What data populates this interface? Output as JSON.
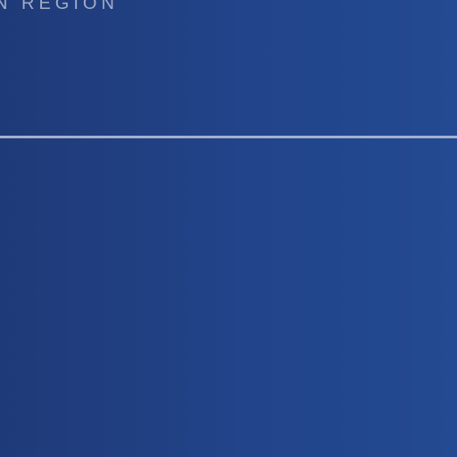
{
  "header": {
    "region_label": "N REGION"
  },
  "colors": {
    "background_start": "#1f3a78",
    "background_end": "#234a92",
    "divider": "#b3bbd8",
    "label": "#b8c0d0"
  }
}
